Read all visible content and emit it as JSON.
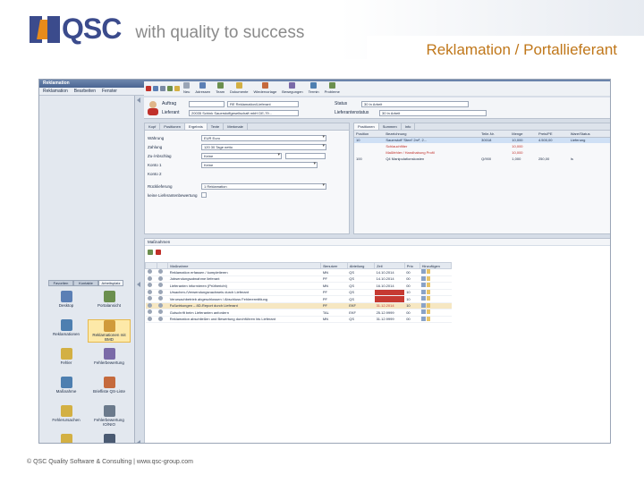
{
  "slide": {
    "logo_text": "QSC",
    "slogan": "with quality to success",
    "title": "Reklamation / Portallieferant",
    "footer": "© QSC Quality Software & Consulting | www.qsc-group.com"
  },
  "app": {
    "window_title": "Reklamation",
    "menu": [
      "Reklamation",
      "Bearbeiten",
      "Fenster"
    ],
    "toolbar": [
      "Neu",
      "Adressen",
      "Team",
      "Dokumente",
      "Wiedervorlage",
      "Bewegungen",
      "Termin",
      "Probleme"
    ],
    "header": {
      "auftrag_label": "Auftrag",
      "auftrag_value": "RE Reklamation/Lieferant",
      "status_label": "Status",
      "status_value": "30 In Arbeit",
      "lieferant_label": "Lieferant",
      "lieferant_value": "20035 Schink Sauerstoffgesellschaft mbH DE-79...",
      "lieferstatus_label": "Lieferantenstatus",
      "lieferstatus_value": "30 In Arbeit"
    },
    "form_tabs": [
      "Kopf",
      "Positionen",
      "Ergebnis",
      "Texte",
      "Merkmale"
    ],
    "form_fields": [
      {
        "label": "Währung",
        "value": "EUR Euro"
      },
      {
        "label": "Zahlung",
        "value": "120 30 Tage netto"
      },
      {
        "label": "Zu-/Abschlag",
        "value": "Keine"
      },
      {
        "label": "Konto 1",
        "value": "Keine"
      },
      {
        "label": "Konto 2",
        "value": ""
      },
      {
        "label": "Rücklieferung",
        "value": "1 Reklamation"
      },
      {
        "label": "keine Lieferantenbewertung",
        "value": ""
      }
    ],
    "pos_tabs": [
      "Positionen",
      "Summen",
      "Info"
    ],
    "pos_columns": [
      "Position",
      "Bezeichnung",
      "Teile-Nr.",
      "Menge",
      "Preis/PE",
      "Ware/Status"
    ],
    "pos_rows": [
      {
        "pos": "10",
        "bez": "Sauerstoff 'Steel' 2m³, 2...",
        "nr": "30018",
        "menge": "10,000",
        "preis": "4.500,00",
        "status": "Lieferung",
        "red": false
      },
      {
        "pos": "",
        "bez": "Schlauchfilter",
        "nr": "",
        "menge": "10,000",
        "preis": "",
        "status": "",
        "red": true
      },
      {
        "pos": "",
        "bez": "Maßfehler / Handhabung Profil",
        "nr": "",
        "menge": "10,000",
        "preis": "",
        "status": "",
        "red": true
      },
      {
        "pos": "100",
        "bez": "Q4 Manipulationskosten",
        "nr": "Q/900",
        "menge": "1,000",
        "preis": "250,00",
        "status": "Is",
        "red": false
      }
    ],
    "tasks_title": "Maßnahmen",
    "task_columns": [
      "",
      "",
      "Maßnahme",
      "Benutzer",
      "Abteilung",
      "Zeil",
      "Prio",
      "Hinzufügen"
    ],
    "task_rows": [
      {
        "name": "Reklamation erfassen / kompletieren",
        "user": "MN",
        "abt": "QS",
        "date": "14.10.2014",
        "prio": "00",
        "red": false,
        "sel": false
      },
      {
        "name": "Jobsendungsabnahme lieferant",
        "user": "PF",
        "abt": "QS",
        "date": "14.10.2014",
        "prio": "00",
        "red": false,
        "sel": false
      },
      {
        "name": "Lieferanten informieren (Prüfbericht)",
        "user": "MN",
        "abt": "QS",
        "date": "16.10.2014",
        "prio": "00",
        "red": false,
        "sel": false
      },
      {
        "name": "Ursachen-/Verwendungsnachweis durch Lieferant",
        "user": "PF",
        "abt": "QS",
        "date": "31.12.2014",
        "prio": "10",
        "red": true,
        "sel": false
      },
      {
        "name": "Verursachbetrieb abgeschlossen / Abschluss Fehlerermittlung",
        "user": "PF",
        "abt": "QS",
        "date": "31.12.2014",
        "prio": "10",
        "red": true,
        "sel": false
      },
      {
        "name": "Fußwirkungen – 8D-Report durch Lieferant",
        "user": "PF",
        "abt": "EKF",
        "date": "31.12.2014",
        "prio": "10",
        "red": true,
        "sel": true
      },
      {
        "name": "Gutschrift beim Lieferanten anfordern",
        "user": "TAL",
        "abt": "EKF",
        "date": "25.12.9999",
        "prio": "00",
        "red": false,
        "sel": false
      },
      {
        "name": "Reklamation abschließen und Bewertung durchführen bis Lieferant",
        "user": "MN",
        "abt": "QS",
        "date": "31.12.9999",
        "prio": "00",
        "red": false,
        "sel": false
      }
    ],
    "left_tabs": [
      "Favoriten",
      "Kontakte",
      "Arbeitsplatz"
    ],
    "left_items": [
      {
        "label": "Desktop",
        "color": "#5b7fb5",
        "sel": false
      },
      {
        "label": "Portalansicht",
        "color": "#6b8f4e",
        "sel": false
      },
      {
        "label": "Reklamationen",
        "color": "#4e7fb0",
        "sel": false
      },
      {
        "label": "Reklamationen mit BMD",
        "color": "#d09a3b",
        "sel": true
      },
      {
        "label": "Fehler",
        "color": "#d3b043",
        "sel": false
      },
      {
        "label": "Fehlerbewertung",
        "color": "#7a6aa8",
        "sel": false
      },
      {
        "label": "Maßnahme",
        "color": "#4e7fb0",
        "sel": false
      },
      {
        "label": "Briefliste QS-Liste",
        "color": "#c56a3d",
        "sel": false
      },
      {
        "label": "Fehlerursachen",
        "color": "#d3b043",
        "sel": false
      },
      {
        "label": "Fehlerbewertung IO/NIO",
        "color": "#6b7a8c",
        "sel": false
      },
      {
        "label": "Fehlerstatistik",
        "color": "#d3b043",
        "sel": false
      },
      {
        "label": "Lieferanten",
        "color": "#4a5a72",
        "sel": false
      }
    ]
  }
}
